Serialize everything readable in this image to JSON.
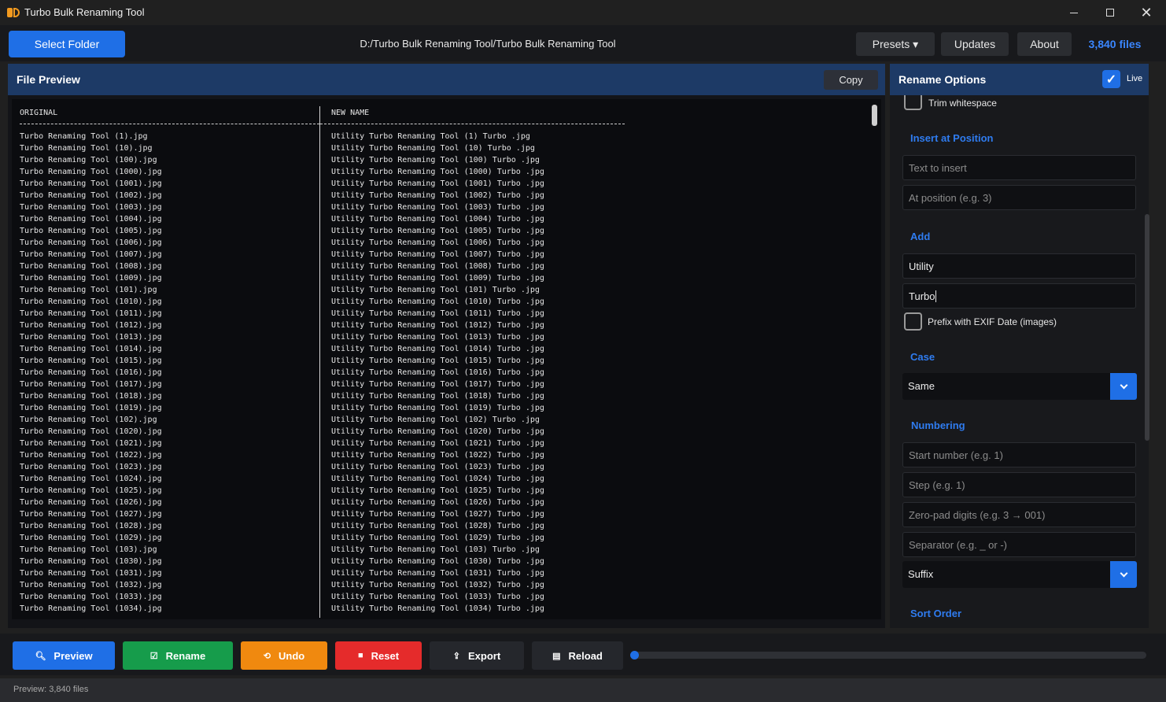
{
  "window": {
    "title": "Turbo Bulk Renaming Tool"
  },
  "toolbar": {
    "select_folder": "Select Folder",
    "path": "D:/Turbo Bulk Renaming Tool/Turbo Bulk Renaming Tool",
    "presets": "Presets ▾",
    "updates": "Updates",
    "about": "About",
    "file_count": "3,840 files"
  },
  "file_preview": {
    "title": "File Preview",
    "copy": "Copy",
    "col_original": "ORIGINAL",
    "col_new": "NEW NAME",
    "original_names": [
      "Turbo Renaming Tool (1).jpg",
      "Turbo Renaming Tool (10).jpg",
      "Turbo Renaming Tool (100).jpg",
      "Turbo Renaming Tool (1000).jpg",
      "Turbo Renaming Tool (1001).jpg",
      "Turbo Renaming Tool (1002).jpg",
      "Turbo Renaming Tool (1003).jpg",
      "Turbo Renaming Tool (1004).jpg",
      "Turbo Renaming Tool (1005).jpg",
      "Turbo Renaming Tool (1006).jpg",
      "Turbo Renaming Tool (1007).jpg",
      "Turbo Renaming Tool (1008).jpg",
      "Turbo Renaming Tool (1009).jpg",
      "Turbo Renaming Tool (101).jpg",
      "Turbo Renaming Tool (1010).jpg",
      "Turbo Renaming Tool (1011).jpg",
      "Turbo Renaming Tool (1012).jpg",
      "Turbo Renaming Tool (1013).jpg",
      "Turbo Renaming Tool (1014).jpg",
      "Turbo Renaming Tool (1015).jpg",
      "Turbo Renaming Tool (1016).jpg",
      "Turbo Renaming Tool (1017).jpg",
      "Turbo Renaming Tool (1018).jpg",
      "Turbo Renaming Tool (1019).jpg",
      "Turbo Renaming Tool (102).jpg",
      "Turbo Renaming Tool (1020).jpg",
      "Turbo Renaming Tool (1021).jpg",
      "Turbo Renaming Tool (1022).jpg",
      "Turbo Renaming Tool (1023).jpg",
      "Turbo Renaming Tool (1024).jpg",
      "Turbo Renaming Tool (1025).jpg",
      "Turbo Renaming Tool (1026).jpg",
      "Turbo Renaming Tool (1027).jpg",
      "Turbo Renaming Tool (1028).jpg",
      "Turbo Renaming Tool (1029).jpg",
      "Turbo Renaming Tool (103).jpg",
      "Turbo Renaming Tool (1030).jpg",
      "Turbo Renaming Tool (1031).jpg",
      "Turbo Renaming Tool (1032).jpg",
      "Turbo Renaming Tool (1033).jpg",
      "Turbo Renaming Tool (1034).jpg"
    ],
    "new_names": [
      "Utility Turbo Renaming Tool (1) Turbo .jpg",
      "Utility Turbo Renaming Tool (10) Turbo .jpg",
      "Utility Turbo Renaming Tool (100) Turbo .jpg",
      "Utility Turbo Renaming Tool (1000) Turbo .jpg",
      "Utility Turbo Renaming Tool (1001) Turbo .jpg",
      "Utility Turbo Renaming Tool (1002) Turbo .jpg",
      "Utility Turbo Renaming Tool (1003) Turbo .jpg",
      "Utility Turbo Renaming Tool (1004) Turbo .jpg",
      "Utility Turbo Renaming Tool (1005) Turbo .jpg",
      "Utility Turbo Renaming Tool (1006) Turbo .jpg",
      "Utility Turbo Renaming Tool (1007) Turbo .jpg",
      "Utility Turbo Renaming Tool (1008) Turbo .jpg",
      "Utility Turbo Renaming Tool (1009) Turbo .jpg",
      "Utility Turbo Renaming Tool (101) Turbo .jpg",
      "Utility Turbo Renaming Tool (1010) Turbo .jpg",
      "Utility Turbo Renaming Tool (1011) Turbo .jpg",
      "Utility Turbo Renaming Tool (1012) Turbo .jpg",
      "Utility Turbo Renaming Tool (1013) Turbo .jpg",
      "Utility Turbo Renaming Tool (1014) Turbo .jpg",
      "Utility Turbo Renaming Tool (1015) Turbo .jpg",
      "Utility Turbo Renaming Tool (1016) Turbo .jpg",
      "Utility Turbo Renaming Tool (1017) Turbo .jpg",
      "Utility Turbo Renaming Tool (1018) Turbo .jpg",
      "Utility Turbo Renaming Tool (1019) Turbo .jpg",
      "Utility Turbo Renaming Tool (102) Turbo .jpg",
      "Utility Turbo Renaming Tool (1020) Turbo .jpg",
      "Utility Turbo Renaming Tool (1021) Turbo .jpg",
      "Utility Turbo Renaming Tool (1022) Turbo .jpg",
      "Utility Turbo Renaming Tool (1023) Turbo .jpg",
      "Utility Turbo Renaming Tool (1024) Turbo .jpg",
      "Utility Turbo Renaming Tool (1025) Turbo .jpg",
      "Utility Turbo Renaming Tool (1026) Turbo .jpg",
      "Utility Turbo Renaming Tool (1027) Turbo .jpg",
      "Utility Turbo Renaming Tool (1028) Turbo .jpg",
      "Utility Turbo Renaming Tool (1029) Turbo .jpg",
      "Utility Turbo Renaming Tool (103) Turbo .jpg",
      "Utility Turbo Renaming Tool (1030) Turbo .jpg",
      "Utility Turbo Renaming Tool (1031) Turbo .jpg",
      "Utility Turbo Renaming Tool (1032) Turbo .jpg",
      "Utility Turbo Renaming Tool (1033) Turbo .jpg",
      "Utility Turbo Renaming Tool (1034) Turbo .jpg"
    ]
  },
  "rename_options": {
    "title": "Rename Options",
    "live_label": "Live",
    "live_checked": true,
    "trim_whitespace_label": "Trim whitespace",
    "insert": {
      "title": "Insert at Position",
      "text_placeholder": "Text to insert",
      "position_placeholder": "At position (e.g. 3)"
    },
    "add": {
      "title": "Add",
      "prefix_value": "Utility",
      "suffix_value": "Turbo",
      "exif_label": "Prefix with EXIF Date (images)",
      "exif_checked": false
    },
    "case": {
      "title": "Case",
      "selected": "Same"
    },
    "numbering": {
      "title": "Numbering",
      "start_placeholder": "Start number (e.g. 1)",
      "step_placeholder": "Step (e.g. 1)",
      "pad_placeholder": "Zero-pad digits (e.g. 3 → 001)",
      "separator_placeholder": "Separator (e.g. _ or -)",
      "position_selected": "Suffix"
    },
    "sort": {
      "title": "Sort Order"
    }
  },
  "actions": {
    "preview": "Preview",
    "rename": "Rename",
    "undo": "Undo",
    "reset": "Reset",
    "export": "Export",
    "reload": "Reload",
    "progress": 0
  },
  "status": {
    "text": "Preview: 3,840 files"
  },
  "colors": {
    "accent": "#1f6fe6",
    "rename": "#169c4b",
    "undo": "#f0890f",
    "reset": "#e52b2b",
    "header": "#1d3a66"
  }
}
